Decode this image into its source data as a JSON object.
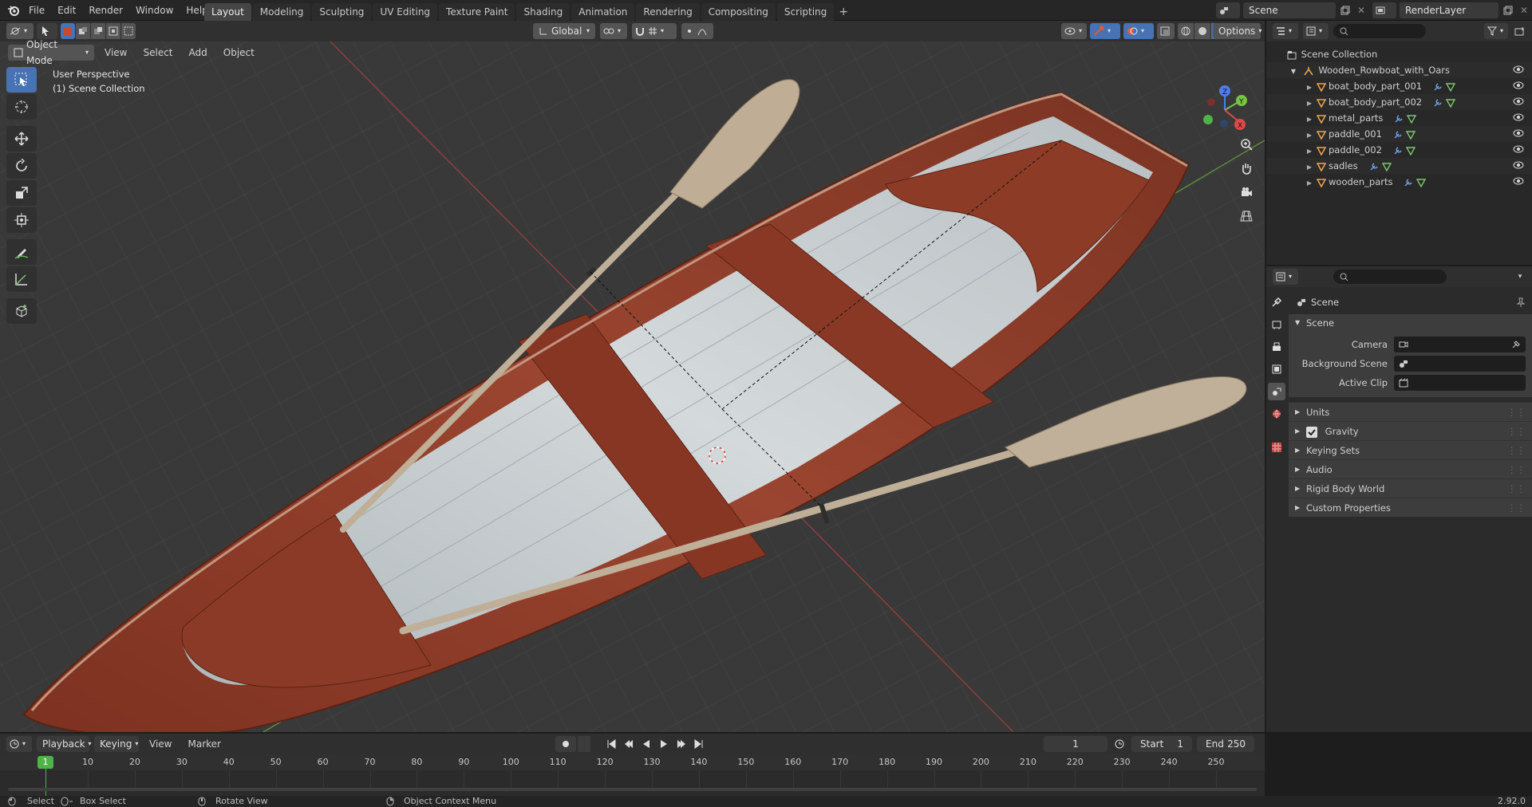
{
  "topbar": {
    "menus": [
      "File",
      "Edit",
      "Render",
      "Window",
      "Help"
    ],
    "workspace_tabs": [
      "Layout",
      "Modeling",
      "Sculpting",
      "UV Editing",
      "Texture Paint",
      "Shading",
      "Animation",
      "Rendering",
      "Compositing",
      "Scripting"
    ],
    "active_tab": "Layout",
    "scene_name": "Scene",
    "view_layer": "RenderLayer"
  },
  "viewport": {
    "mode": "Object Mode",
    "menus": [
      "View",
      "Select",
      "Add",
      "Object"
    ],
    "orientation": "Global",
    "options_label": "Options",
    "overlay_text_1": "User Perspective",
    "overlay_text_2": "(1) Scene Collection",
    "gizmo_axes": [
      "X",
      "Y",
      "Z"
    ]
  },
  "outliner": {
    "root": "Scene Collection",
    "collection": "Wooden_Rowboat_with_Oars",
    "objects": [
      "boat_body_part_001",
      "boat_body_part_002",
      "metal_parts",
      "paddle_001",
      "paddle_002",
      "sadles",
      "wooden_parts"
    ]
  },
  "properties": {
    "context_title": "Scene",
    "panel_title": "Scene",
    "fields": [
      {
        "label": "Camera",
        "value": ""
      },
      {
        "label": "Background Scene",
        "value": ""
      },
      {
        "label": "Active Clip",
        "value": ""
      }
    ],
    "subpanels": [
      "Units",
      "Gravity",
      "Keying Sets",
      "Audio",
      "Rigid Body World",
      "Custom Properties"
    ],
    "gravity_checked": true
  },
  "timeline": {
    "menus": [
      "Playback",
      "Keying",
      "View",
      "Marker"
    ],
    "current_frame": "1",
    "start_label": "Start",
    "start_value": "1",
    "end_label": "End",
    "end_value": "250",
    "ruler": [
      "1",
      "10",
      "20",
      "30",
      "40",
      "50",
      "60",
      "70",
      "80",
      "90",
      "100",
      "110",
      "120",
      "130",
      "140",
      "150",
      "160",
      "170",
      "180",
      "190",
      "200",
      "210",
      "220",
      "230",
      "240",
      "250"
    ]
  },
  "statusbar": {
    "select": "Select",
    "box_select": "Box Select",
    "rotate_view": "Rotate View",
    "context_menu": "Object Context Menu",
    "version": "2.92.0"
  },
  "colors": {
    "accent": "#4772b3",
    "hull_red": "#8e3a26",
    "wood_white": "#c9cfd2",
    "oar": "#c4b39b",
    "frame_green": "#4fb349"
  }
}
